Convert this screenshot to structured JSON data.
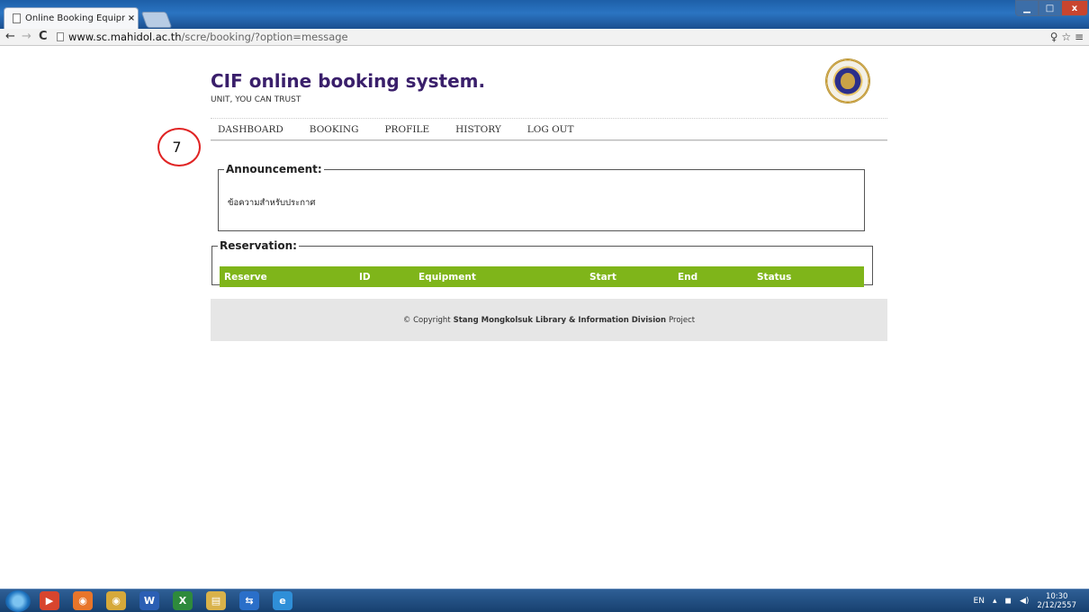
{
  "browser": {
    "tab_title": "Online Booking Equipmer",
    "tab_close": "×",
    "url_host": "www.sc.mahidol.ac.th",
    "url_path": "/scre/booking/?option=message",
    "back": "←",
    "forward": "→",
    "reload": "C",
    "tools": "♀ ☆ ≡",
    "minimize": "▁",
    "maximize": "□",
    "close": "x"
  },
  "site": {
    "title": "CIF online booking system.",
    "tagline": "UNIT, YOU CAN TRUST"
  },
  "menu": [
    "DASHBOARD",
    "BOOKING",
    "PROFILE",
    "HISTORY",
    "LOG OUT"
  ],
  "annotation_number": "7",
  "announcement": {
    "legend": "Announcement:",
    "text": "ข้อความสำหรับประกาศ"
  },
  "reservation": {
    "legend": "Reservation:",
    "columns": [
      "Reserve",
      "ID",
      "Equipment",
      "Start",
      "End",
      "Status"
    ]
  },
  "footer": {
    "prefix": "© Copyright",
    "org": "Stang Mongkolsuk Library & Information Division",
    "suffix": "Project"
  },
  "taskbar": {
    "apps": [
      {
        "icon": "media-player-icon",
        "label": "▶",
        "color": "#d8452e"
      },
      {
        "icon": "firefox-icon",
        "label": "◉",
        "color": "#e8752a"
      },
      {
        "icon": "chrome-icon",
        "label": "◉",
        "color": "#d6a93a"
      },
      {
        "icon": "word-icon",
        "label": "W",
        "color": "#2b5fb4"
      },
      {
        "icon": "excel-icon",
        "label": "X",
        "color": "#2e8a3c"
      },
      {
        "icon": "explorer-icon",
        "label": "▤",
        "color": "#d9b24a"
      },
      {
        "icon": "teamviewer-icon",
        "label": "⇆",
        "color": "#2a6fc9"
      },
      {
        "icon": "ie-icon",
        "label": "e",
        "color": "#2f8fd8"
      }
    ],
    "lang": "EN",
    "time": "10:30",
    "date": "2/12/2557"
  }
}
